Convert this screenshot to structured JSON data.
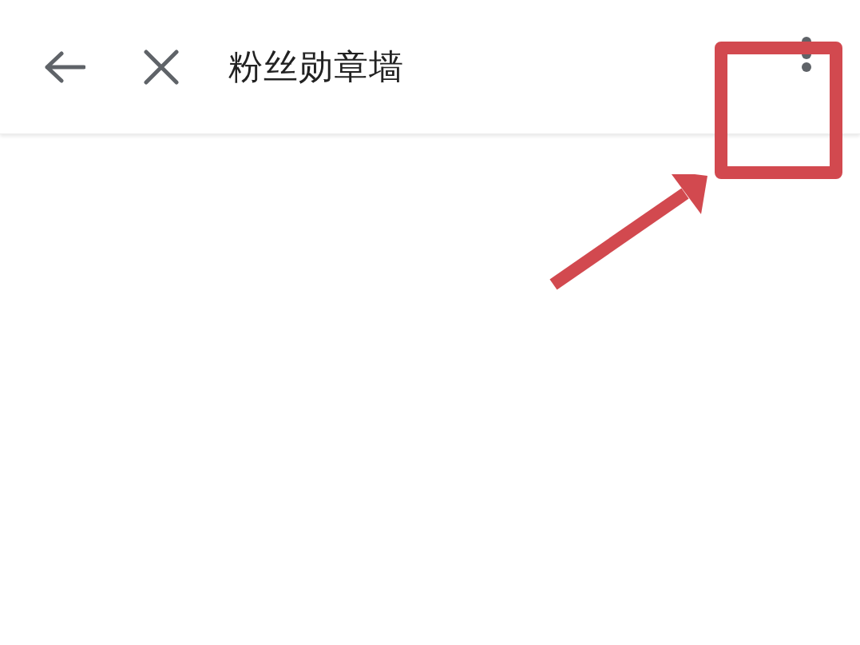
{
  "header": {
    "title": "粉丝勋章墙"
  }
}
